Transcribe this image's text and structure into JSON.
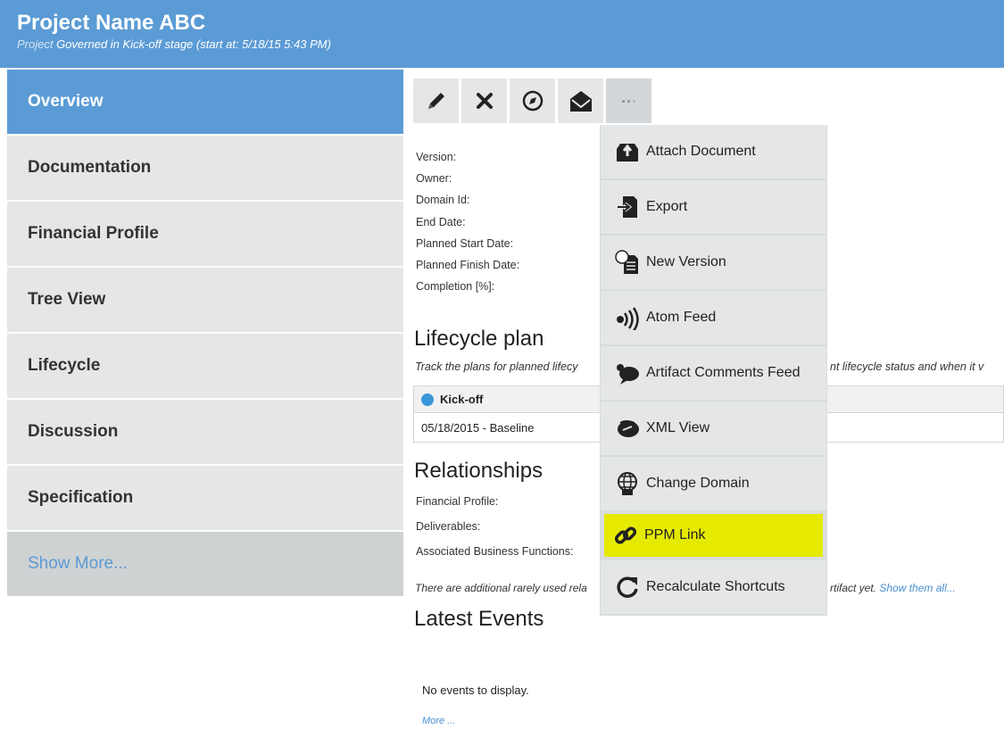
{
  "header": {
    "title": "Project Name ABC",
    "kind": "Project",
    "subtitle": "Governed in Kick-off stage (start at: 5/18/15 5:43 PM)"
  },
  "sidebar": {
    "items": [
      {
        "label": "Overview",
        "active": true
      },
      {
        "label": "Documentation"
      },
      {
        "label": "Financial Profile"
      },
      {
        "label": "Tree View"
      },
      {
        "label": "Lifecycle"
      },
      {
        "label": "Discussion"
      },
      {
        "label": "Specification"
      }
    ],
    "show_more": "Show More..."
  },
  "toolbar": {
    "buttons": [
      "pencil-icon",
      "close-x-icon",
      "compass-icon",
      "envelope-icon",
      "more-dots-icon"
    ]
  },
  "properties": [
    "Version:",
    "Owner:",
    "Domain Id:",
    "End Date:",
    "Planned Start Date:",
    "Planned Finish Date:",
    "Completion [%]:"
  ],
  "lifecycle": {
    "heading": "Lifecycle plan",
    "desc_left": "Track the plans for planned lifecy",
    "desc_right": "nt lifecycle status and when it v",
    "stage": "Kick-off",
    "stage_color": "#3a96d9",
    "row": "05/18/2015 - Baseline"
  },
  "relationships": {
    "heading": "Relationships",
    "items": [
      "Financial Profile:",
      "Deliverables:",
      "Associated Business Functions:"
    ],
    "note_left": "There are additional rarely used rela",
    "note_right": "rtifact yet.",
    "note_link": "Show them all..."
  },
  "events": {
    "heading": "Latest Events",
    "empty": "No events to display.",
    "more": "More ..."
  },
  "dropdown": {
    "items": [
      {
        "label": "Attach Document",
        "icon": "attach-document-icon"
      },
      {
        "label": "Export",
        "icon": "export-icon"
      },
      {
        "label": "New Version",
        "icon": "new-version-icon"
      },
      {
        "label": "Atom Feed",
        "icon": "atom-feed-icon"
      },
      {
        "label": "Artifact Comments Feed",
        "icon": "comments-feed-icon"
      },
      {
        "label": "XML View",
        "icon": "xml-view-icon"
      },
      {
        "label": "Change Domain",
        "icon": "globe-icon"
      },
      {
        "label": "PPM Link",
        "icon": "link-icon",
        "highlighted": true
      },
      {
        "label": "Recalculate Shortcuts",
        "icon": "refresh-icon"
      }
    ],
    "highlight_color": "#e6ea00"
  },
  "colors": {
    "accent": "#5b9bd5",
    "link": "#4a8fd0",
    "panel": "#e4e6e7"
  }
}
